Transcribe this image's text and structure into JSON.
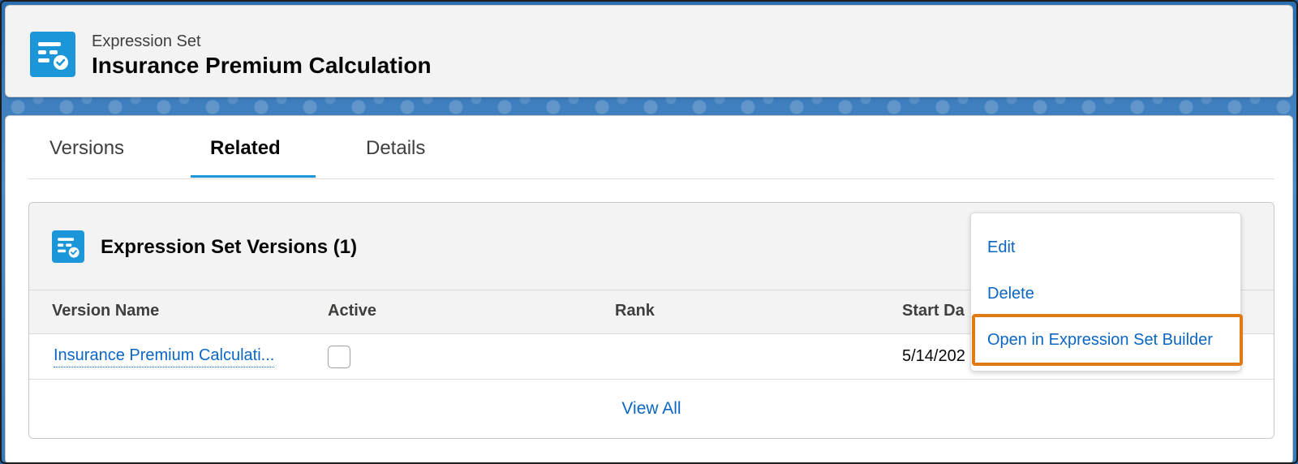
{
  "header": {
    "object_type": "Expression Set",
    "record_name": "Insurance Premium Calculation",
    "icon": "expression-set-icon"
  },
  "tabs": [
    {
      "label": "Versions",
      "active": false
    },
    {
      "label": "Related",
      "active": true
    },
    {
      "label": "Details",
      "active": false
    }
  ],
  "related_list": {
    "icon": "expression-set-icon",
    "title": "Expression Set Versions (1)",
    "columns": [
      "Version Name",
      "Active",
      "Rank",
      "Start Da"
    ],
    "rows": [
      {
        "version_name": "Insurance Premium Calculati...",
        "active": false,
        "rank": "",
        "start_date": "5/14/202"
      }
    ],
    "view_all": "View All"
  },
  "menu": {
    "items": [
      "Edit",
      "Delete",
      "Open in Expression Set Builder"
    ],
    "highlighted_item": "Open in Expression Set Builder",
    "highlight_color": "#e07b12"
  },
  "colors": {
    "brand": "#1b96d8",
    "link": "#0b66c3"
  }
}
